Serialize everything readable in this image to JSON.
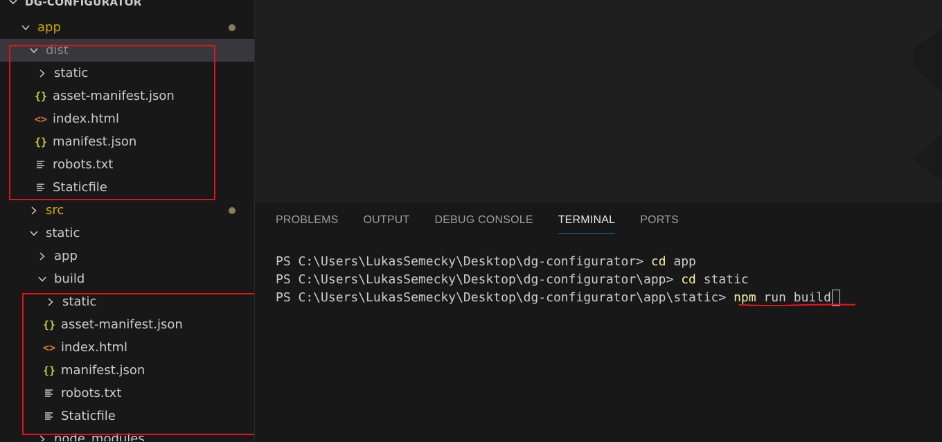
{
  "explorer": {
    "root_label": "DG-CONFIGURATOR",
    "rows": [
      {
        "label": "app",
        "kind": "folder-open",
        "modified": true
      },
      {
        "label": "dist",
        "kind": "folder-open",
        "dimmed": true,
        "selected": true
      },
      {
        "label": "static",
        "kind": "folder-closed"
      },
      {
        "label": "asset-manifest.json",
        "kind": "json"
      },
      {
        "label": "index.html",
        "kind": "html"
      },
      {
        "label": "manifest.json",
        "kind": "json"
      },
      {
        "label": "robots.txt",
        "kind": "txt"
      },
      {
        "label": "Staticfile",
        "kind": "txt"
      },
      {
        "label": "src",
        "kind": "folder-closed",
        "modified": true
      },
      {
        "label": "static",
        "kind": "folder-open"
      },
      {
        "label": "app",
        "kind": "folder-closed"
      },
      {
        "label": "build",
        "kind": "folder-open"
      },
      {
        "label": "static",
        "kind": "folder-closed"
      },
      {
        "label": "asset-manifest.json",
        "kind": "json"
      },
      {
        "label": "index.html",
        "kind": "html"
      },
      {
        "label": "manifest.json",
        "kind": "json"
      },
      {
        "label": "robots.txt",
        "kind": "txt"
      },
      {
        "label": "Staticfile",
        "kind": "txt"
      },
      {
        "label": "node_modules",
        "kind": "folder-closed"
      }
    ],
    "json_glyph": "{}",
    "html_glyph": "<>"
  },
  "panel": {
    "tabs": [
      "PROBLEMS",
      "OUTPUT",
      "DEBUG CONSOLE",
      "TERMINAL",
      "PORTS"
    ],
    "active_tab": "TERMINAL",
    "terminal": [
      {
        "prompt": "PS C:\\Users\\LukasSemecky\\Desktop\\dg-configurator> ",
        "cmd": "cd",
        "args": " app"
      },
      {
        "prompt": "PS C:\\Users\\LukasSemecky\\Desktop\\dg-configurator\\app> ",
        "cmd": "cd",
        "args": " static"
      },
      {
        "prompt": "PS C:\\Users\\LukasSemecky\\Desktop\\dg-configurator\\app\\static> ",
        "cmd": "npm",
        "args": " run build"
      }
    ]
  },
  "colors": {
    "annotation_red": "#e51414",
    "accent": "#0078d4",
    "command_yellow": "#f9f1a5"
  }
}
